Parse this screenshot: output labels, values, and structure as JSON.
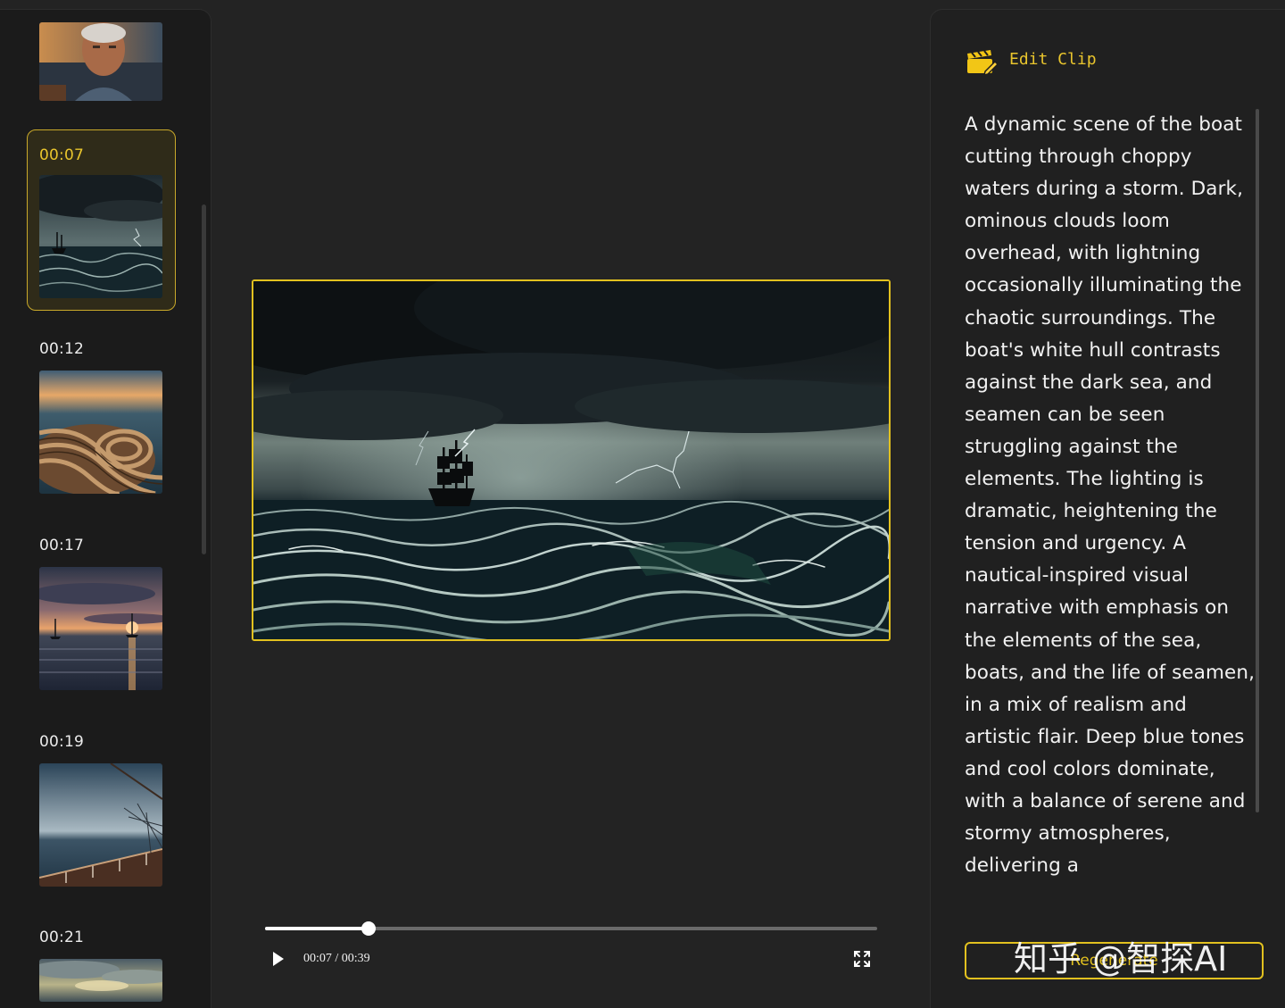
{
  "sidebar": {
    "clips": [
      {
        "time": "",
        "scene": "old-seaman-portrait"
      },
      {
        "time": "00:07",
        "scene": "ship-in-storm",
        "selected": true
      },
      {
        "time": "00:12",
        "scene": "coiled-rope-at-sunset"
      },
      {
        "time": "00:17",
        "scene": "sailboats-at-sunset"
      },
      {
        "time": "00:19",
        "scene": "ship-deck-and-net"
      },
      {
        "time": "00:21",
        "scene": "cloudy-sky"
      }
    ]
  },
  "player": {
    "current_time": "00:07",
    "duration": "00:39",
    "time_display": "00:07 / 00:39",
    "progress_fraction": 0.1687,
    "play_icon": "play-icon",
    "fullscreen_icon": "fullscreen-icon"
  },
  "edit_panel": {
    "title": "Edit Clip",
    "icon": "clapperboard-edit-icon",
    "description": "A dynamic scene of the boat cutting through choppy waters during a storm. Dark, ominous clouds loom overhead, with lightning occasionally illuminating the chaotic surroundings. The boat's white hull contrasts against the dark sea, and seamen can be seen struggling against the elements. The lighting is dramatic, heightening the tension and urgency. A nautical-inspired visual narrative with emphasis on the elements of the sea, boats, and the life of seamen, in a mix of realism and artistic flair. Deep blue tones and cool colors dominate, with a balance of serene and stormy atmospheres, delivering a",
    "regenerate_label": "Regenerate"
  },
  "watermark": "知乎 @智探AI",
  "colors": {
    "accent": "#e2c11f",
    "accent_text": "#e9c52d",
    "background": "#232323",
    "sidebar_bg": "#1b1b1b",
    "selected_bg": "#2f2b19"
  }
}
